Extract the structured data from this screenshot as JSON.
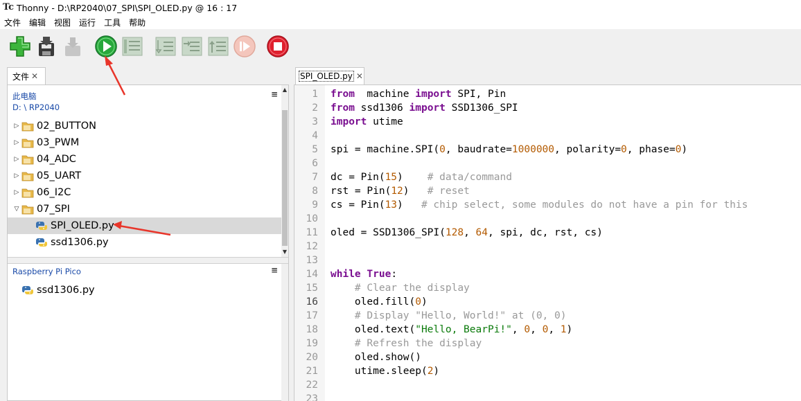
{
  "titlebar": {
    "title": "Thonny  -  D:\\RP2040\\07_SPI\\SPI_OLED.py  @  16 : 17"
  },
  "menubar": {
    "items": [
      "文件",
      "编辑",
      "视图",
      "运行",
      "工具",
      "帮助"
    ]
  },
  "toolbar": {
    "buttons": [
      "new-file",
      "save-file",
      "load-file",
      "run",
      "debug",
      "step-over",
      "step-into",
      "step-out",
      "resume",
      "stop"
    ]
  },
  "files_panel": {
    "tab_label": "文件",
    "tab_close": "✕",
    "computer": {
      "header": "此电脑",
      "path": "D: \\ RP2040",
      "items": [
        {
          "name": "02_BUTTON",
          "type": "folder",
          "expanded": false
        },
        {
          "name": "03_PWM",
          "type": "folder",
          "expanded": false
        },
        {
          "name": "04_ADC",
          "type": "folder",
          "expanded": false
        },
        {
          "name": "05_UART",
          "type": "folder",
          "expanded": false
        },
        {
          "name": "06_I2C",
          "type": "folder",
          "expanded": false
        },
        {
          "name": "07_SPI",
          "type": "folder",
          "expanded": true
        },
        {
          "name": "SPI_OLED.py",
          "type": "python",
          "selected": true
        },
        {
          "name": "ssd1306.py",
          "type": "python"
        }
      ]
    },
    "device": {
      "header": "Raspberry Pi Pico",
      "items": [
        {
          "name": "ssd1306.py",
          "type": "python"
        }
      ]
    },
    "menu_glyph": "≡"
  },
  "editor": {
    "tab_label": "SPI_OLED.py",
    "tab_close": "✕",
    "current_line": 16,
    "line_numbers": [
      "1",
      "2",
      "3",
      "4",
      "5",
      "6",
      "7",
      "8",
      "9",
      "10",
      "11",
      "12",
      "13",
      "14",
      "15",
      "16",
      "17",
      "18",
      "19",
      "20",
      "21",
      "22",
      "23"
    ],
    "lines": [
      [
        [
          "kw",
          "from"
        ],
        [
          "",
          "  machine "
        ],
        [
          "kw",
          "import"
        ],
        [
          "",
          " SPI, Pin"
        ]
      ],
      [
        [
          "kw",
          "from"
        ],
        [
          "",
          " ssd1306 "
        ],
        [
          "kw",
          "import"
        ],
        [
          "",
          " SSD1306_SPI"
        ]
      ],
      [
        [
          "kw",
          "import"
        ],
        [
          "",
          " utime"
        ]
      ],
      [],
      [
        [
          "",
          "spi = machine.SPI("
        ],
        [
          "num",
          "0"
        ],
        [
          "",
          ", baudrate="
        ],
        [
          "num",
          "1000000"
        ],
        [
          "",
          ", polarity="
        ],
        [
          "num",
          "0"
        ],
        [
          "",
          ", phase="
        ],
        [
          "num",
          "0"
        ],
        [
          "",
          ")"
        ]
      ],
      [],
      [
        [
          "",
          "dc = Pin("
        ],
        [
          "num",
          "15"
        ],
        [
          "",
          ")    "
        ],
        [
          "cmt",
          "# data/command"
        ]
      ],
      [
        [
          "",
          "rst = Pin("
        ],
        [
          "num",
          "12"
        ],
        [
          "",
          ")   "
        ],
        [
          "cmt",
          "# reset"
        ]
      ],
      [
        [
          "",
          "cs = Pin("
        ],
        [
          "num",
          "13"
        ],
        [
          "",
          ")   "
        ],
        [
          "cmt",
          "# chip select, some modules do not have a pin for this"
        ]
      ],
      [],
      [
        [
          "",
          "oled = SSD1306_SPI("
        ],
        [
          "num",
          "128"
        ],
        [
          "",
          ", "
        ],
        [
          "num",
          "64"
        ],
        [
          "",
          ", spi, dc, rst, cs)"
        ]
      ],
      [],
      [],
      [
        [
          "kw",
          "while"
        ],
        [
          "",
          " "
        ],
        [
          "kw",
          "True"
        ],
        [
          "",
          ":"
        ]
      ],
      [
        [
          "",
          "    "
        ],
        [
          "cmt",
          "# Clear the display"
        ]
      ],
      [
        [
          "",
          "    oled.fill("
        ],
        [
          "num",
          "0"
        ],
        [
          "",
          ")"
        ]
      ],
      [
        [
          "",
          "    "
        ],
        [
          "cmt",
          "# Display \"Hello, World!\" at (0, 0)"
        ]
      ],
      [
        [
          "",
          "    oled.text("
        ],
        [
          "str",
          "\"Hello, BearPi!\""
        ],
        [
          "",
          ", "
        ],
        [
          "num",
          "0"
        ],
        [
          "",
          ", "
        ],
        [
          "num",
          "0"
        ],
        [
          "",
          ", "
        ],
        [
          "num",
          "1"
        ],
        [
          "",
          ")"
        ]
      ],
      [
        [
          "",
          "    "
        ],
        [
          "cmt",
          "# Refresh the display"
        ]
      ],
      [
        [
          "",
          "    oled.show()"
        ]
      ],
      [
        [
          "",
          "    utime.sleep("
        ],
        [
          "num",
          "2"
        ],
        [
          "",
          ")"
        ]
      ],
      [],
      []
    ]
  },
  "colors": {
    "keyword": "#7a0f90",
    "number": "#b35a00",
    "string": "#0a7a0a",
    "comment": "#999999",
    "arrow": "#e8352a",
    "path_blue": "#1a4aa8"
  }
}
